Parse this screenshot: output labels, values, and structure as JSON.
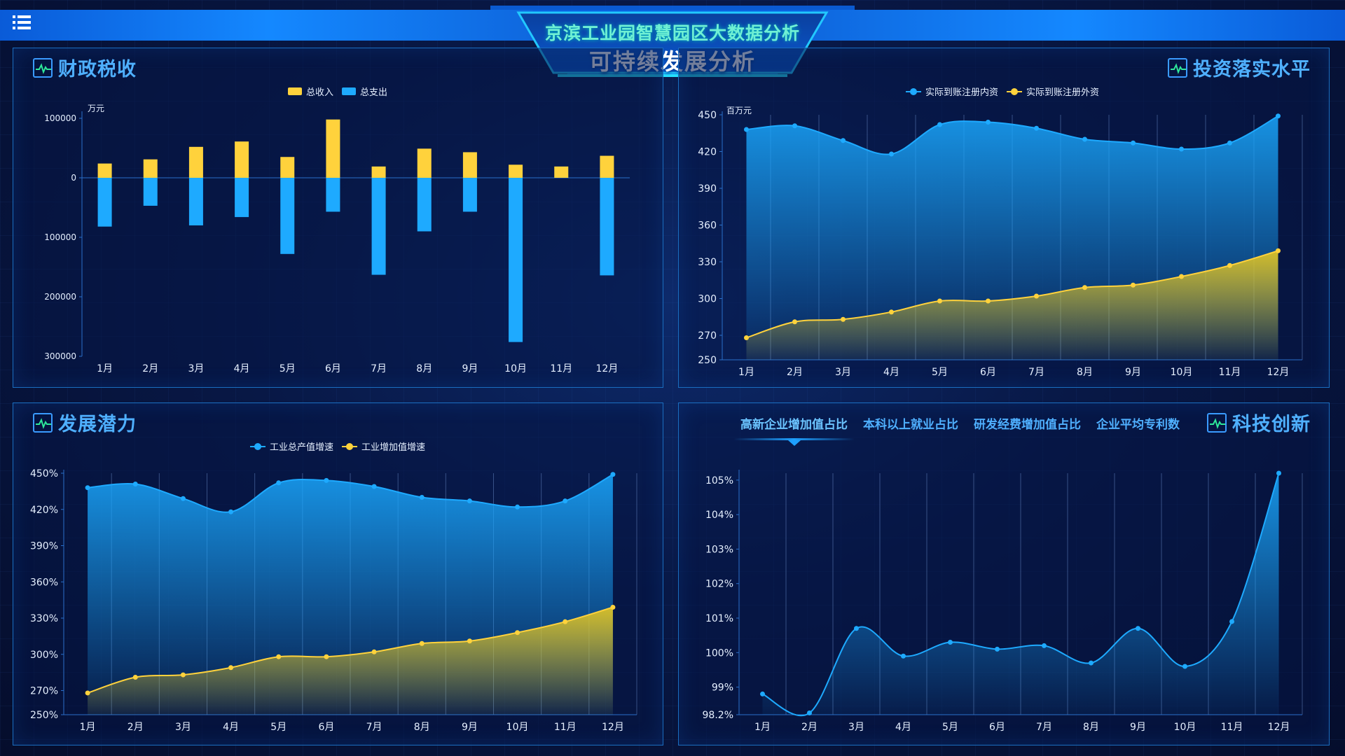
{
  "header": {
    "title_line1": "京滨工业园智慧园区大数据分析",
    "title_line2": "可持续发展分析"
  },
  "panels": {
    "fiscal": {
      "title": "财政税收"
    },
    "investment": {
      "title": "投资落实水平"
    },
    "potential": {
      "title": "发展潜力"
    },
    "tech": {
      "title": "科技创新",
      "tabs": [
        "高新企业增加值占比",
        "本科以上就业占比",
        "研发经费增加值占比",
        "企业平均专利数"
      ],
      "active_tab": 0
    }
  },
  "colors": {
    "yellow": "#ffd23c",
    "blue": "#1eaaff",
    "accent": "#4fb0ff"
  },
  "chart_data": [
    {
      "id": "fiscal",
      "type": "bar",
      "unit": "万元",
      "categories": [
        "1月",
        "2月",
        "3月",
        "4月",
        "5月",
        "6月",
        "7月",
        "8月",
        "9月",
        "10月",
        "11月",
        "12月"
      ],
      "series": [
        {
          "name": "总收入",
          "values": [
            24000,
            31000,
            52000,
            61000,
            35000,
            98000,
            19000,
            49000,
            43000,
            22000,
            19000,
            37000
          ]
        },
        {
          "name": "总支出",
          "values": [
            -82000,
            -47000,
            -80000,
            -66000,
            -128000,
            -57000,
            -163000,
            -90000,
            -57000,
            -276000,
            0,
            -164000
          ]
        }
      ],
      "ylim": [
        -300000,
        100000
      ],
      "yticks": [
        100000,
        0,
        -100000,
        -200000,
        -300000
      ],
      "ytick_labels": [
        "100000",
        "0",
        "100000",
        "200000",
        "300000"
      ]
    },
    {
      "id": "investment",
      "type": "area",
      "unit": "百万元",
      "categories": [
        "1月",
        "2月",
        "3月",
        "4月",
        "5月",
        "6月",
        "7月",
        "8月",
        "9月",
        "10月",
        "11月",
        "12月"
      ],
      "series": [
        {
          "name": "实际到账注册内资",
          "values": [
            438,
            441,
            429,
            418,
            442,
            444,
            439,
            430,
            427,
            422,
            427,
            449
          ]
        },
        {
          "name": "实际到账注册外资",
          "values": [
            268,
            281,
            283,
            289,
            298,
            298,
            302,
            309,
            311,
            318,
            327,
            339
          ]
        }
      ],
      "ylim": [
        250,
        450
      ],
      "yticks": [
        250,
        270,
        300,
        330,
        360,
        390,
        420,
        450
      ]
    },
    {
      "id": "potential",
      "type": "area",
      "categories": [
        "1月",
        "2月",
        "3月",
        "4月",
        "5月",
        "6月",
        "7月",
        "8月",
        "9月",
        "10月",
        "11月",
        "12月"
      ],
      "series": [
        {
          "name": "工业总产值增速",
          "values": [
            438,
            441,
            429,
            418,
            442,
            444,
            439,
            430,
            427,
            422,
            427,
            449
          ]
        },
        {
          "name": "工业增加值增速",
          "values": [
            268,
            281,
            283,
            289,
            298,
            298,
            302,
            309,
            311,
            318,
            327,
            339
          ]
        }
      ],
      "ylim": [
        250,
        450
      ],
      "yticks": [
        250,
        270,
        300,
        330,
        360,
        390,
        420,
        450
      ],
      "ytick_suffix": "%"
    },
    {
      "id": "tech",
      "type": "area",
      "categories": [
        "1月",
        "2月",
        "3月",
        "4月",
        "5月",
        "6月",
        "7月",
        "8月",
        "9月",
        "10月",
        "11月",
        "12月"
      ],
      "series": [
        {
          "values": [
            98.8,
            98.25,
            100.7,
            99.9,
            100.3,
            100.1,
            100.2,
            99.7,
            100.7,
            99.6,
            100.9,
            105.2
          ]
        }
      ],
      "ylim": [
        98.2,
        105.2
      ],
      "yticks": [
        98.2,
        99,
        100,
        101,
        102,
        103,
        104,
        105
      ],
      "ytick_labels": [
        "98.2%",
        "99%",
        "100%",
        "101%",
        "102%",
        "103%",
        "104%",
        "105%"
      ]
    }
  ]
}
